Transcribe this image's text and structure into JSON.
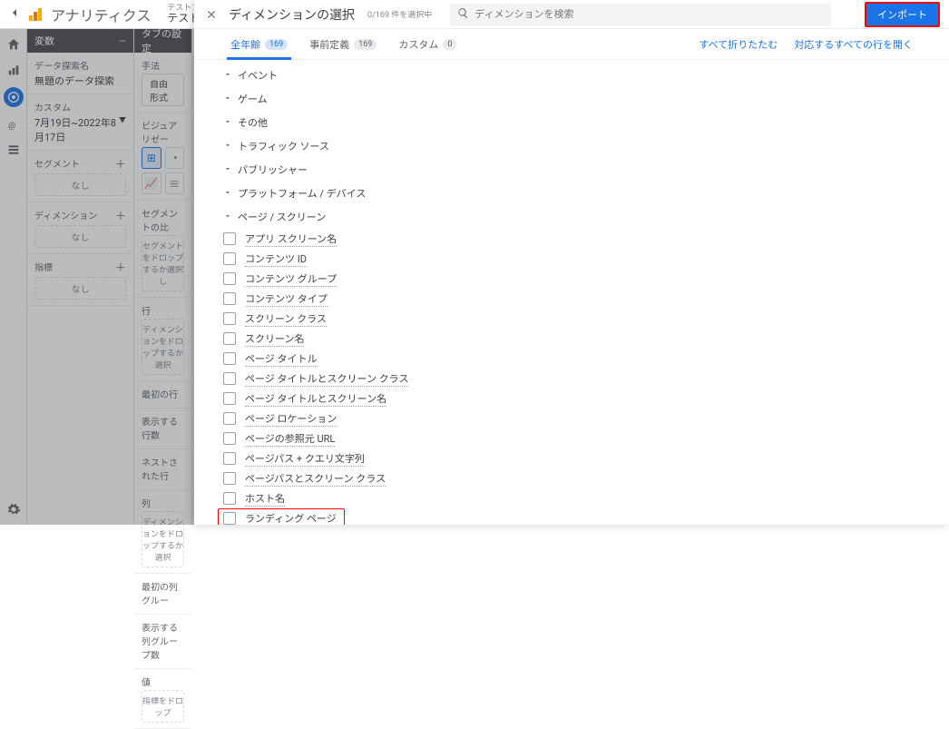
{
  "header": {
    "app_title": "アナリティクス",
    "property_small": "テストプロパティ",
    "property_main": "テストプロ"
  },
  "panel1": {
    "title": "変数",
    "section1_label": "データ探索名",
    "section1_value": "無題のデータ探索",
    "section2_label": "カスタム",
    "section2_value": "7月19日~2022年8月17日",
    "section3_label": "セグメント",
    "section4_label": "ディメンション",
    "section5_label": "指標",
    "none": "なし"
  },
  "panel2": {
    "title": "タブの設定",
    "tech_label": "手法",
    "tech_value": "自由形式",
    "viz_label": "ビジュアリゼー",
    "segcmp_label": "セグメントの比",
    "segcmp_drop": "セグメントをドロップするか選択し",
    "rows_label": "行",
    "rows_drop": "ディメンションをドロップするか選択",
    "firstrow_label": "最初の行",
    "showrows_label": "表示する行数",
    "nested_label": "ネストされた行",
    "cols_label": "列",
    "cols_drop": "ディメンションをドロップするか選択",
    "firstcolgroup_label": "最初の列グルー",
    "showcolgroup_label": "表示する列グループ数",
    "values_label": "値",
    "values_drop": "指標をドロップ"
  },
  "modal": {
    "title": "ディメンションの選択",
    "subtitle": "0/169 件を選択中",
    "search_placeholder": "ディメンションを検索",
    "import_label": "インポート",
    "tabs": {
      "all": "全年齢",
      "all_count": "169",
      "predef": "事前定義",
      "predef_count": "169",
      "custom": "カスタム",
      "custom_count": "0"
    },
    "right_links": {
      "collapse_all": "すべて折りたたむ",
      "expand_all": "対応するすべての行を開く"
    },
    "groups": [
      {
        "name": "イベント",
        "open": false
      },
      {
        "name": "ゲーム",
        "open": false
      },
      {
        "name": "その他",
        "open": false
      },
      {
        "name": "トラフィック ソース",
        "open": false
      },
      {
        "name": "パブリッシャー",
        "open": false
      },
      {
        "name": "プラットフォーム / デバイス",
        "open": false
      },
      {
        "name": "ページ / スクリーン",
        "open": true
      }
    ],
    "page_items": [
      "アプリ スクリーン名",
      "コンテンツ ID",
      "コンテンツ グループ",
      "コンテンツ タイプ",
      "スクリーン クラス",
      "スクリーン名",
      "ページ タイトル",
      "ページ タイトルとスクリーン クラス",
      "ページ タイトルとスクリーン名",
      "ページ ロケーション",
      "ページの参照元 URL",
      "ページパス + クエリ文字列",
      "ページパスとスクリーン クラス",
      "ホスト名",
      "ランディング ページ"
    ],
    "highlight_index": 14
  }
}
